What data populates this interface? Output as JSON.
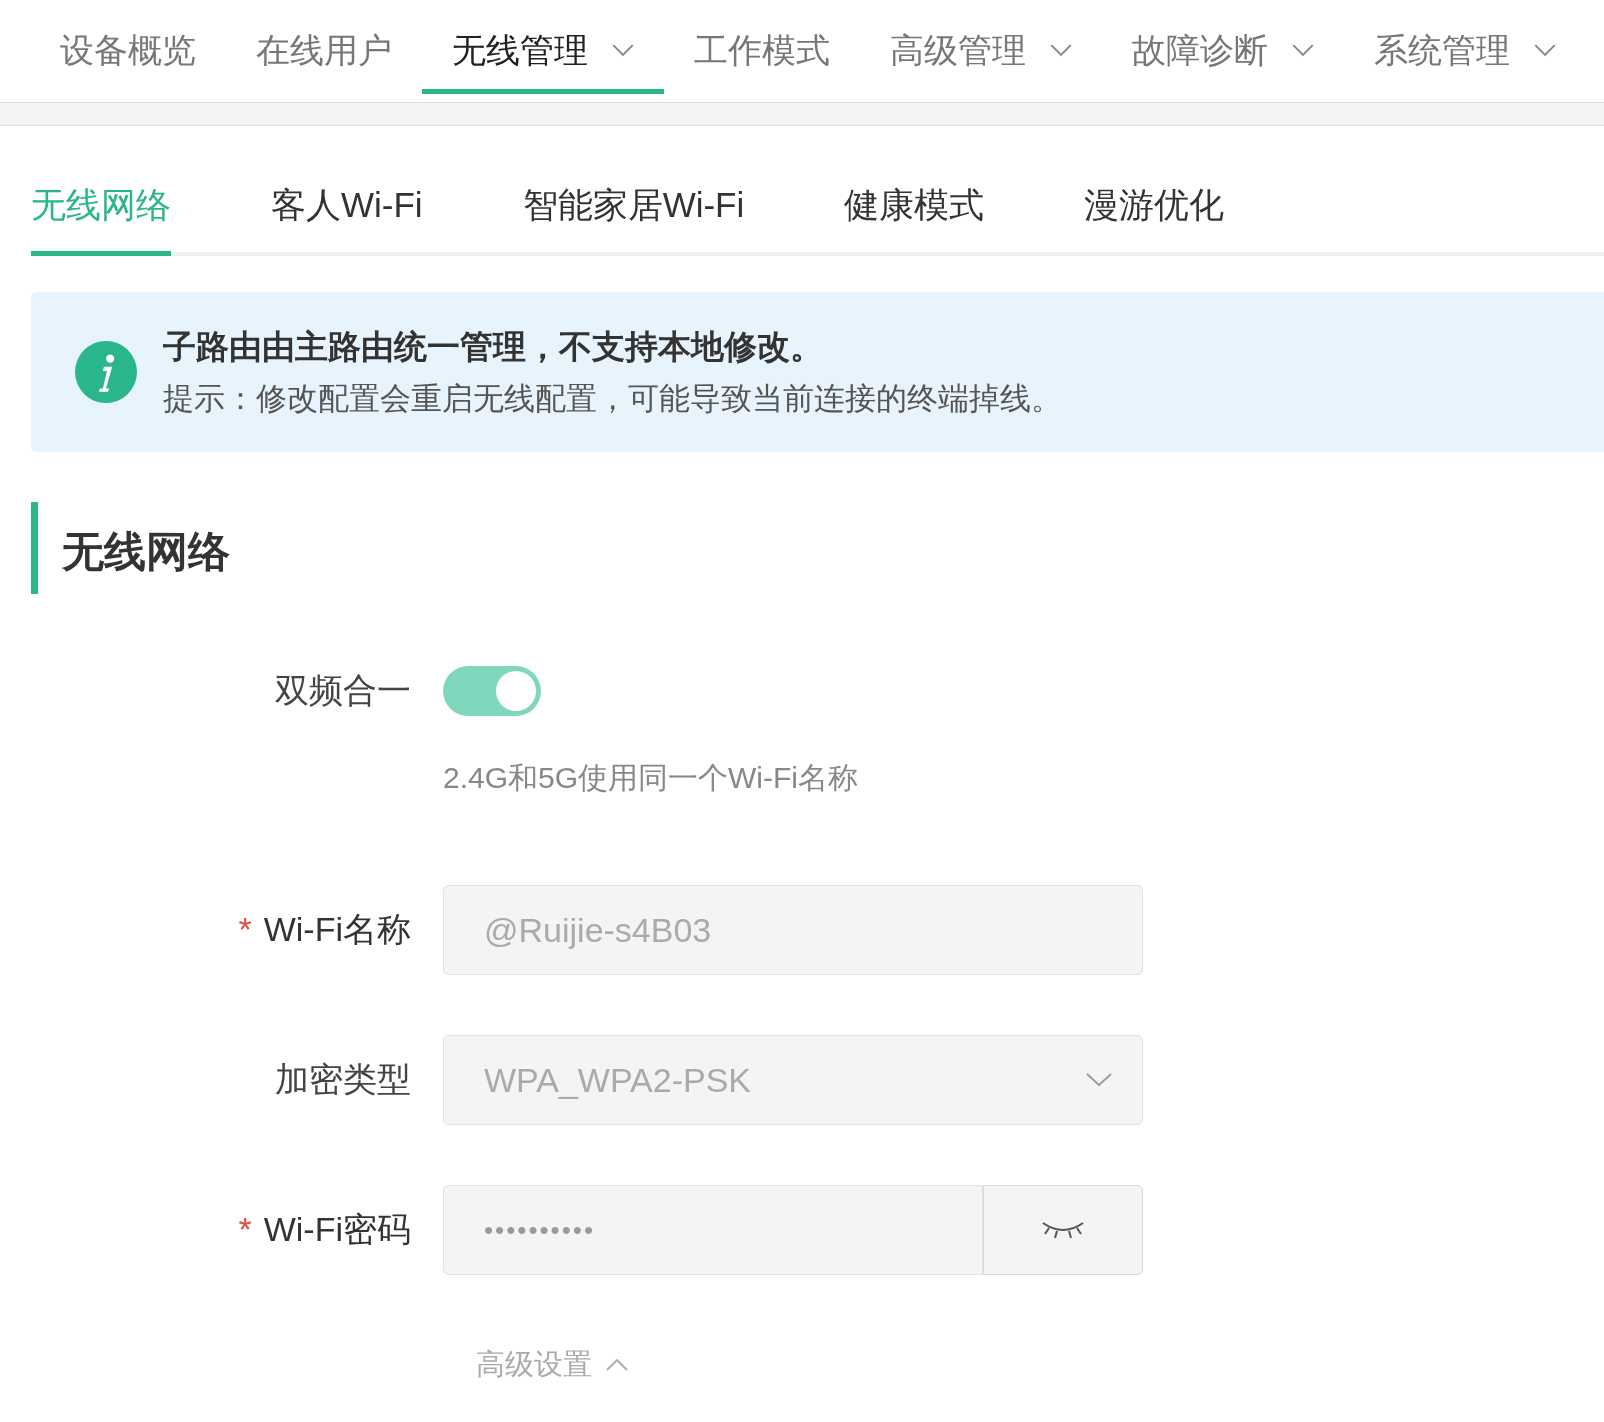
{
  "top_nav": [
    {
      "label": "设备概览",
      "selected": false,
      "has_dropdown": false
    },
    {
      "label": "在线用户",
      "selected": false,
      "has_dropdown": false
    },
    {
      "label": "无线管理",
      "selected": true,
      "has_dropdown": true
    },
    {
      "label": "工作模式",
      "selected": false,
      "has_dropdown": false
    },
    {
      "label": "高级管理",
      "selected": false,
      "has_dropdown": true
    },
    {
      "label": "故障诊断",
      "selected": false,
      "has_dropdown": true
    },
    {
      "label": "系统管理",
      "selected": false,
      "has_dropdown": true
    }
  ],
  "sub_tabs": [
    {
      "label": "无线网络",
      "selected": true
    },
    {
      "label": "客人Wi-Fi",
      "selected": false
    },
    {
      "label": "智能家居Wi-Fi",
      "selected": false
    },
    {
      "label": "健康模式",
      "selected": false
    },
    {
      "label": "漫游优化",
      "selected": false
    }
  ],
  "notice": {
    "title": "子路由由主路由统一管理，不支持本地修改。",
    "text": "提示：修改配置会重启无线配置，可能导致当前连接的终端掉线。"
  },
  "section_title": "无线网络",
  "form": {
    "required_mark": "*",
    "dual_band": {
      "label": "双频合一",
      "on": true,
      "hint": "2.4G和5G使用同一个Wi-Fi名称"
    },
    "fields": [
      {
        "kind": "text",
        "label": "Wi-Fi名称",
        "required": true,
        "value": "@Ruijie-s4B03"
      },
      {
        "kind": "select",
        "label": "加密类型",
        "required": false,
        "value": "WPA_WPA2-PSK"
      },
      {
        "kind": "password",
        "label": "Wi-Fi密码",
        "required": true,
        "value": "••••••••••"
      }
    ]
  },
  "advanced_toggle": {
    "label": "高级设置",
    "expanded": true
  }
}
